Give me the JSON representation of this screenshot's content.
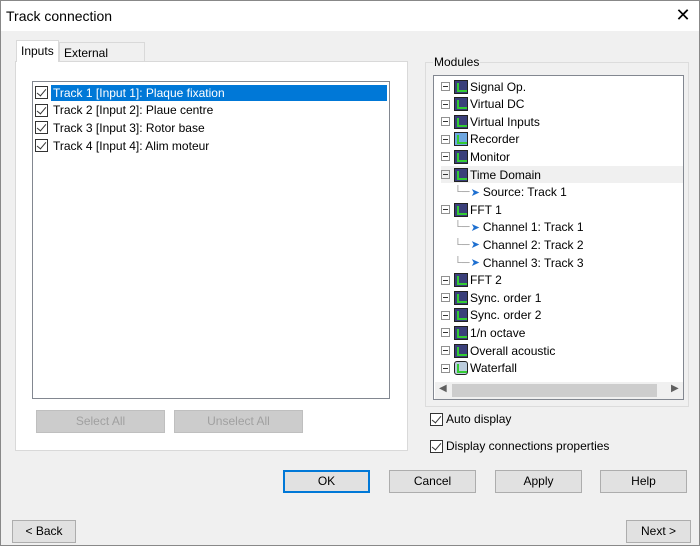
{
  "window": {
    "title": "Track connection",
    "close_icon": "close-icon"
  },
  "tabs": [
    {
      "label": "Inputs",
      "selected": true
    },
    {
      "label": "External Syncs",
      "selected": false
    }
  ],
  "tracks": [
    {
      "label": "Track 1 [Input 1]: Plaque fixation",
      "checked": true,
      "selected": true
    },
    {
      "label": "Track 2 [Input 2]: Plaue centre",
      "checked": true
    },
    {
      "label": "Track 3 [Input 3]: Rotor base",
      "checked": true
    },
    {
      "label": "Track 4 [Input 4]: Alim moteur",
      "checked": true
    }
  ],
  "select_all": "Select All",
  "unselect_all": "Unselect All",
  "modules": {
    "label": "Modules",
    "items": [
      {
        "label": "Signal Op.",
        "icon": "module-icon"
      },
      {
        "label": "Virtual DC",
        "icon": "module-icon"
      },
      {
        "label": "Virtual Inputs",
        "icon": "module-icon"
      },
      {
        "label": "Recorder",
        "icon": "recorder-icon"
      },
      {
        "label": "Monitor",
        "icon": "module-icon"
      },
      {
        "label": "Time Domain",
        "icon": "module-icon",
        "highlighted": true
      },
      {
        "label": "Source: Track 1",
        "child": true
      },
      {
        "label": "FFT 1",
        "icon": "module-icon"
      },
      {
        "label": "Channel 1: Track 1",
        "child": true
      },
      {
        "label": "Channel 2: Track 2",
        "child": true
      },
      {
        "label": "Channel 3: Track 3",
        "child": true
      },
      {
        "label": "FFT 2",
        "icon": "module-icon"
      },
      {
        "label": "Sync. order 1",
        "icon": "module-icon"
      },
      {
        "label": "Sync. order 2",
        "icon": "module-icon"
      },
      {
        "label": "1/n octave",
        "icon": "module-icon"
      },
      {
        "label": "Overall acoustic",
        "icon": "module-icon"
      },
      {
        "label": "Waterfall",
        "icon": "waterfall-icon"
      }
    ]
  },
  "auto_display": {
    "label": "Auto display",
    "checked": true
  },
  "display_conn": {
    "label": "Display connections properties",
    "checked": true
  },
  "buttons": {
    "ok": "OK",
    "cancel": "Cancel",
    "apply": "Apply",
    "help": "Help",
    "back": "< Back",
    "next": "Next >"
  },
  "colors": {
    "selection": "#0078d7"
  }
}
